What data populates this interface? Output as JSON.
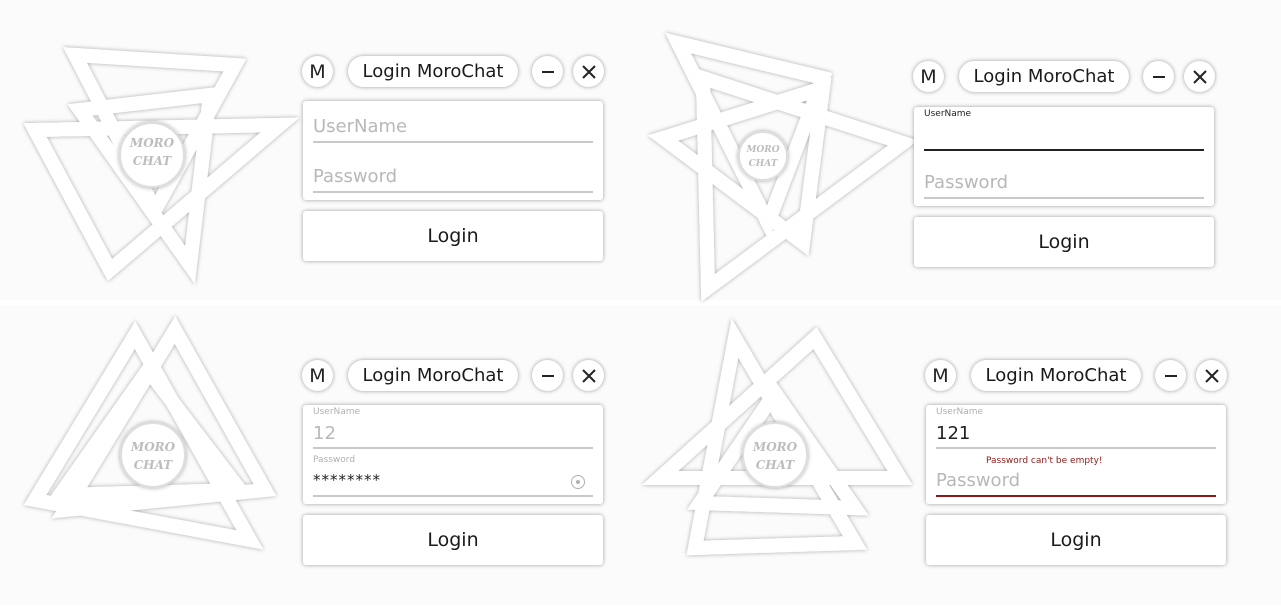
{
  "window_title": "Login MoroChat",
  "m_label": "M",
  "minimize_icon": "minus-icon",
  "close_icon": "close-icon",
  "login_label": "Login",
  "logo_text": [
    "MORO",
    "CHAT"
  ],
  "username_placeholder": "UserName",
  "password_placeholder": "Password",
  "floating_username": "UserName",
  "floating_password": "Password",
  "state_filled": {
    "username_value": "12",
    "password_value": "********"
  },
  "state_error": {
    "username_value": "121",
    "password_error": "Password can't be empty!"
  },
  "colors": {
    "error": "#8b1a1a",
    "focus_line": "#222222",
    "idle_line": "#c9c9c9"
  }
}
